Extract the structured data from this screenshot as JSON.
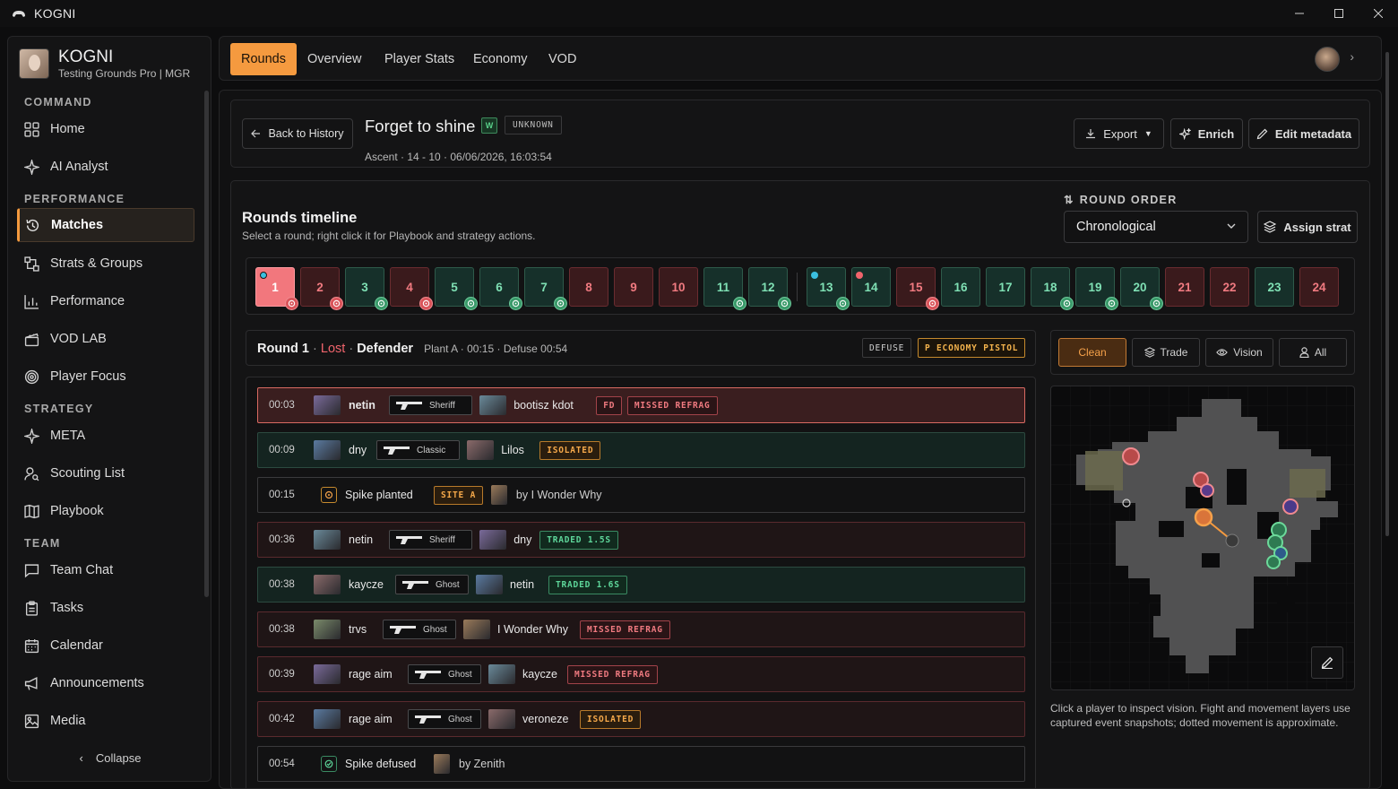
{
  "window": {
    "title": "KOGNI"
  },
  "profile": {
    "name": "KOGNI",
    "subtitle": "Testing Grounds Pro | MGR"
  },
  "nav": {
    "sections": [
      "COMMAND",
      "PERFORMANCE",
      "STRATEGY",
      "TEAM"
    ],
    "items": [
      {
        "label": "Home",
        "icon": "grid-icon"
      },
      {
        "label": "AI Analyst",
        "icon": "sparkle-icon"
      },
      {
        "label": "Matches",
        "icon": "history-icon",
        "active": true
      },
      {
        "label": "Strats & Groups",
        "icon": "strats-icon"
      },
      {
        "label": "Performance",
        "icon": "bar-chart-icon"
      },
      {
        "label": "VOD LAB",
        "icon": "clapper-icon"
      },
      {
        "label": "Player Focus",
        "icon": "target-icon"
      },
      {
        "label": "META",
        "icon": "sparkle-icon"
      },
      {
        "label": "Scouting List",
        "icon": "user-search-icon"
      },
      {
        "label": "Playbook",
        "icon": "book-icon"
      },
      {
        "label": "Team Chat",
        "icon": "chat-icon"
      },
      {
        "label": "Tasks",
        "icon": "clipboard-icon"
      },
      {
        "label": "Calendar",
        "icon": "calendar-icon"
      },
      {
        "label": "Announcements",
        "icon": "megaphone-icon"
      },
      {
        "label": "Media",
        "icon": "image-icon"
      }
    ],
    "collapse_label": "Collapse"
  },
  "tabs": [
    {
      "label": "Rounds",
      "active": true
    },
    {
      "label": "Overview"
    },
    {
      "label": "Player Stats"
    },
    {
      "label": "Economy"
    },
    {
      "label": "VOD"
    }
  ],
  "match": {
    "back_label": "Back to History",
    "title": "Forget to shine",
    "result_badge": "W",
    "status_badge": "UNKNOWN",
    "meta": "Ascent · 14 - 10 · 06/06/2026, 16:03:54",
    "export_label": "Export",
    "enrich_label": "Enrich",
    "edit_label": "Edit metadata"
  },
  "timeline": {
    "title": "Rounds timeline",
    "subtitle": "Select a round; right click it for Playbook and strategy actions.",
    "order_label": "ROUND ORDER",
    "order_value": "Chronological",
    "assign_label": "Assign strat",
    "rounds": [
      {
        "n": "1",
        "result": "loss",
        "selected": true,
        "icon": "red",
        "dot": "cyan"
      },
      {
        "n": "2",
        "result": "loss",
        "icon": "red"
      },
      {
        "n": "3",
        "result": "win",
        "icon": "green"
      },
      {
        "n": "4",
        "result": "loss",
        "icon": "red"
      },
      {
        "n": "5",
        "result": "win",
        "icon": "green"
      },
      {
        "n": "6",
        "result": "win",
        "icon": "green"
      },
      {
        "n": "7",
        "result": "win",
        "icon": "green"
      },
      {
        "n": "8",
        "result": "loss"
      },
      {
        "n": "9",
        "result": "loss"
      },
      {
        "n": "10",
        "result": "loss"
      },
      {
        "n": "11",
        "result": "win",
        "icon": "green"
      },
      {
        "n": "12",
        "result": "win",
        "icon": "green"
      },
      {
        "n": "13",
        "result": "win",
        "icon": "green",
        "dot": "cyan"
      },
      {
        "n": "14",
        "result": "win",
        "dot": "red"
      },
      {
        "n": "15",
        "result": "loss",
        "icon": "red"
      },
      {
        "n": "16",
        "result": "win"
      },
      {
        "n": "17",
        "result": "win"
      },
      {
        "n": "18",
        "result": "win",
        "icon": "green"
      },
      {
        "n": "19",
        "result": "win",
        "icon": "green"
      },
      {
        "n": "20",
        "result": "win",
        "icon": "green"
      },
      {
        "n": "21",
        "result": "loss"
      },
      {
        "n": "22",
        "result": "loss"
      },
      {
        "n": "23",
        "result": "win"
      },
      {
        "n": "24",
        "result": "loss"
      }
    ]
  },
  "round": {
    "title": "Round 1",
    "result": "Lost",
    "side": "Defender",
    "details": "Plant A · 00:15 · Defuse 00:54",
    "tag_defuse": "DEFUSE",
    "tag_economy": "P ECONOMY PISTOL"
  },
  "events": [
    {
      "time": "00:03",
      "killer": "netin",
      "weapon": "Sheriff",
      "victim": "bootisz kdot",
      "tags": [
        {
          "t": "FD",
          "c": "red"
        },
        {
          "t": "MISSED REFRAG",
          "c": "red"
        }
      ],
      "style": "sel"
    },
    {
      "time": "00:09",
      "killer": "dny",
      "weapon": "Classic",
      "victim": "Lilos",
      "tags": [
        {
          "t": "ISOLATED",
          "c": "orange"
        }
      ],
      "style": "kill-green"
    },
    {
      "time": "00:15",
      "type": "plant",
      "text": "Spike planted",
      "site": "SITE A",
      "by": "by I Wonder Why"
    },
    {
      "time": "00:36",
      "killer": "netin",
      "weapon": "Sheriff",
      "victim": "dny",
      "tags": [
        {
          "t": "TRADED 1.5S",
          "c": "green"
        }
      ],
      "style": "kill-red"
    },
    {
      "time": "00:38",
      "killer": "kaycze",
      "weapon": "Ghost",
      "victim": "netin",
      "tags": [
        {
          "t": "TRADED 1.6S",
          "c": "green"
        }
      ],
      "style": "kill-green"
    },
    {
      "time": "00:38",
      "killer": "trvs",
      "weapon": "Ghost",
      "victim": "I Wonder Why",
      "tags": [
        {
          "t": "MISSED REFRAG",
          "c": "red"
        }
      ],
      "style": "kill-red"
    },
    {
      "time": "00:39",
      "killer": "rage aim",
      "weapon": "Ghost",
      "victim": "kaycze",
      "tags": [
        {
          "t": "MISSED REFRAG",
          "c": "red"
        }
      ],
      "style": "kill-red"
    },
    {
      "time": "00:42",
      "killer": "rage aim",
      "weapon": "Ghost",
      "victim": "veroneze",
      "tags": [
        {
          "t": "ISOLATED",
          "c": "orange"
        }
      ],
      "style": "kill-red"
    },
    {
      "time": "00:54",
      "type": "defuse",
      "text": "Spike defused",
      "by": "by Zenith"
    }
  ],
  "filters": [
    {
      "label": "Clean",
      "active": true
    },
    {
      "label": "Trade",
      "icon": "layers-icon"
    },
    {
      "label": "Vision",
      "icon": "eye-icon"
    },
    {
      "label": "All",
      "icon": "user-icon"
    }
  ],
  "map_note": "Click a player to inspect vision. Fight and movement layers use captured event snapshots; dotted movement is approximate.",
  "colors": {
    "accent": "#f59a3f",
    "win": "#7fe0b4",
    "loss": "#f07a80"
  }
}
